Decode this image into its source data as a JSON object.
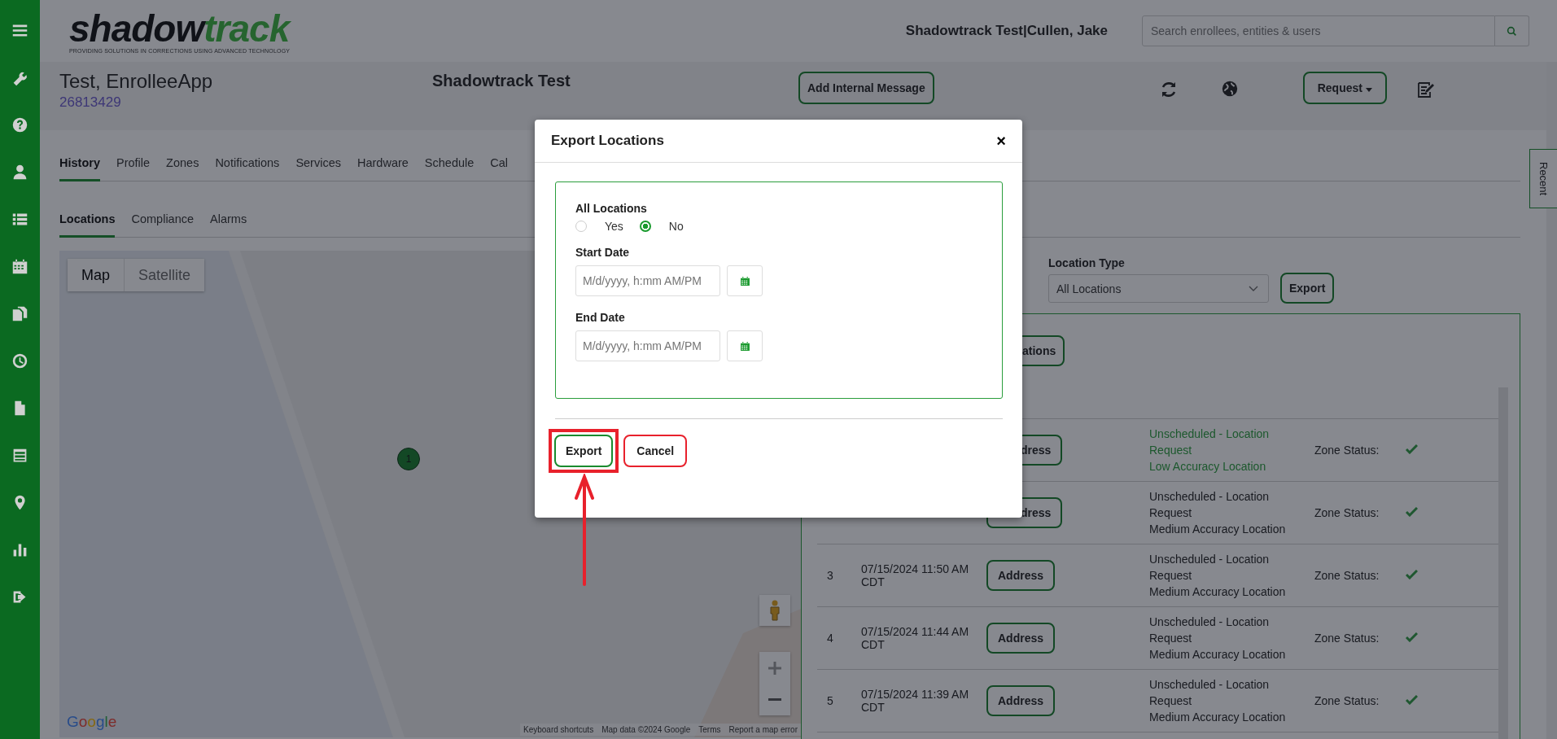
{
  "header": {
    "logo": [
      "shadow",
      "track"
    ],
    "tagline": "PROVIDING SOLUTIONS IN CORRECTIONS USING ADVANCED TECHNOLOGY",
    "user": "Shadowtrack Test|Cullen, Jake",
    "search": {
      "placeholder": "Search enrollees, entities & users"
    }
  },
  "enrollee": {
    "name": "Test, EnrolleeApp",
    "id": "26813429",
    "agency": "Shadowtrack Test",
    "message_button": "Add Internal Message",
    "request_button": "Request"
  },
  "tabs": [
    {
      "label": "History",
      "selected": true
    },
    {
      "label": "Profile",
      "selected": false
    },
    {
      "label": "Zones",
      "selected": false
    },
    {
      "label": "Notifications",
      "selected": false
    },
    {
      "label": "Services",
      "selected": false
    },
    {
      "label": "Hardware",
      "selected": false
    },
    {
      "label": "Schedule",
      "selected": false
    },
    {
      "label": "Cal",
      "selected": false
    }
  ],
  "subtabs": [
    {
      "label": "Locations",
      "selected": true
    },
    {
      "label": "Compliance",
      "selected": false
    },
    {
      "label": "Alarms",
      "selected": false
    }
  ],
  "recent_tab": "Recent",
  "map": {
    "modes": [
      {
        "label": "Map",
        "selected": true
      },
      {
        "label": "Satellite",
        "selected": false
      }
    ],
    "marker": "1",
    "logo": "Google",
    "attribution": [
      "Keyboard shortcuts",
      "Map data ©2024 Google",
      "Terms",
      "Report a map error"
    ]
  },
  "filters": {
    "location_type": {
      "label": "Location Type",
      "value": "All Locations"
    },
    "export_button": "Export"
  },
  "table": {
    "top_button": "ations",
    "rows": [
      {
        "number": "",
        "date": "",
        "address_button": "dress",
        "type": "Unscheduled - Location Request",
        "accuracy": "Low Accuracy Location",
        "highlighted": true,
        "zone_label": "Zone Status:",
        "zone_ok": true
      },
      {
        "number": "",
        "date": "",
        "address_button": "dress",
        "type": "Unscheduled - Location Request",
        "accuracy": "Medium Accuracy Location",
        "highlighted": false,
        "zone_label": "Zone Status:",
        "zone_ok": true
      },
      {
        "number": "3",
        "date": "07/15/2024 11:50 AM CDT",
        "address_button": "Address",
        "type": "Unscheduled - Location Request",
        "accuracy": "Medium Accuracy Location",
        "highlighted": false,
        "zone_label": "Zone Status:",
        "zone_ok": true
      },
      {
        "number": "4",
        "date": "07/15/2024 11:44 AM CDT",
        "address_button": "Address",
        "type": "Unscheduled - Location Request",
        "accuracy": "Medium Accuracy Location",
        "highlighted": false,
        "zone_label": "Zone Status:",
        "zone_ok": true
      },
      {
        "number": "5",
        "date": "07/15/2024 11:39 AM CDT",
        "address_button": "Address",
        "type": "Unscheduled - Location Request",
        "accuracy": "Medium Accuracy Location",
        "highlighted": false,
        "zone_label": "Zone Status:",
        "zone_ok": true
      }
    ]
  },
  "dialog": {
    "title": "Export Locations",
    "close": "×",
    "all_locations": {
      "label": "All Locations",
      "options": [
        {
          "label": "Yes",
          "selected": false
        },
        {
          "label": "No",
          "selected": true
        }
      ]
    },
    "start_date": {
      "label": "Start Date",
      "placeholder": "M/d/yyyy, h:mm AM/PM"
    },
    "end_date": {
      "label": "End Date",
      "placeholder": "M/d/yyyy, h:mm AM/PM"
    },
    "buttons": [
      {
        "label": "Export",
        "kind": "primary",
        "annotated": true
      },
      {
        "label": "Cancel",
        "kind": "cancel",
        "annotated": false
      }
    ]
  }
}
